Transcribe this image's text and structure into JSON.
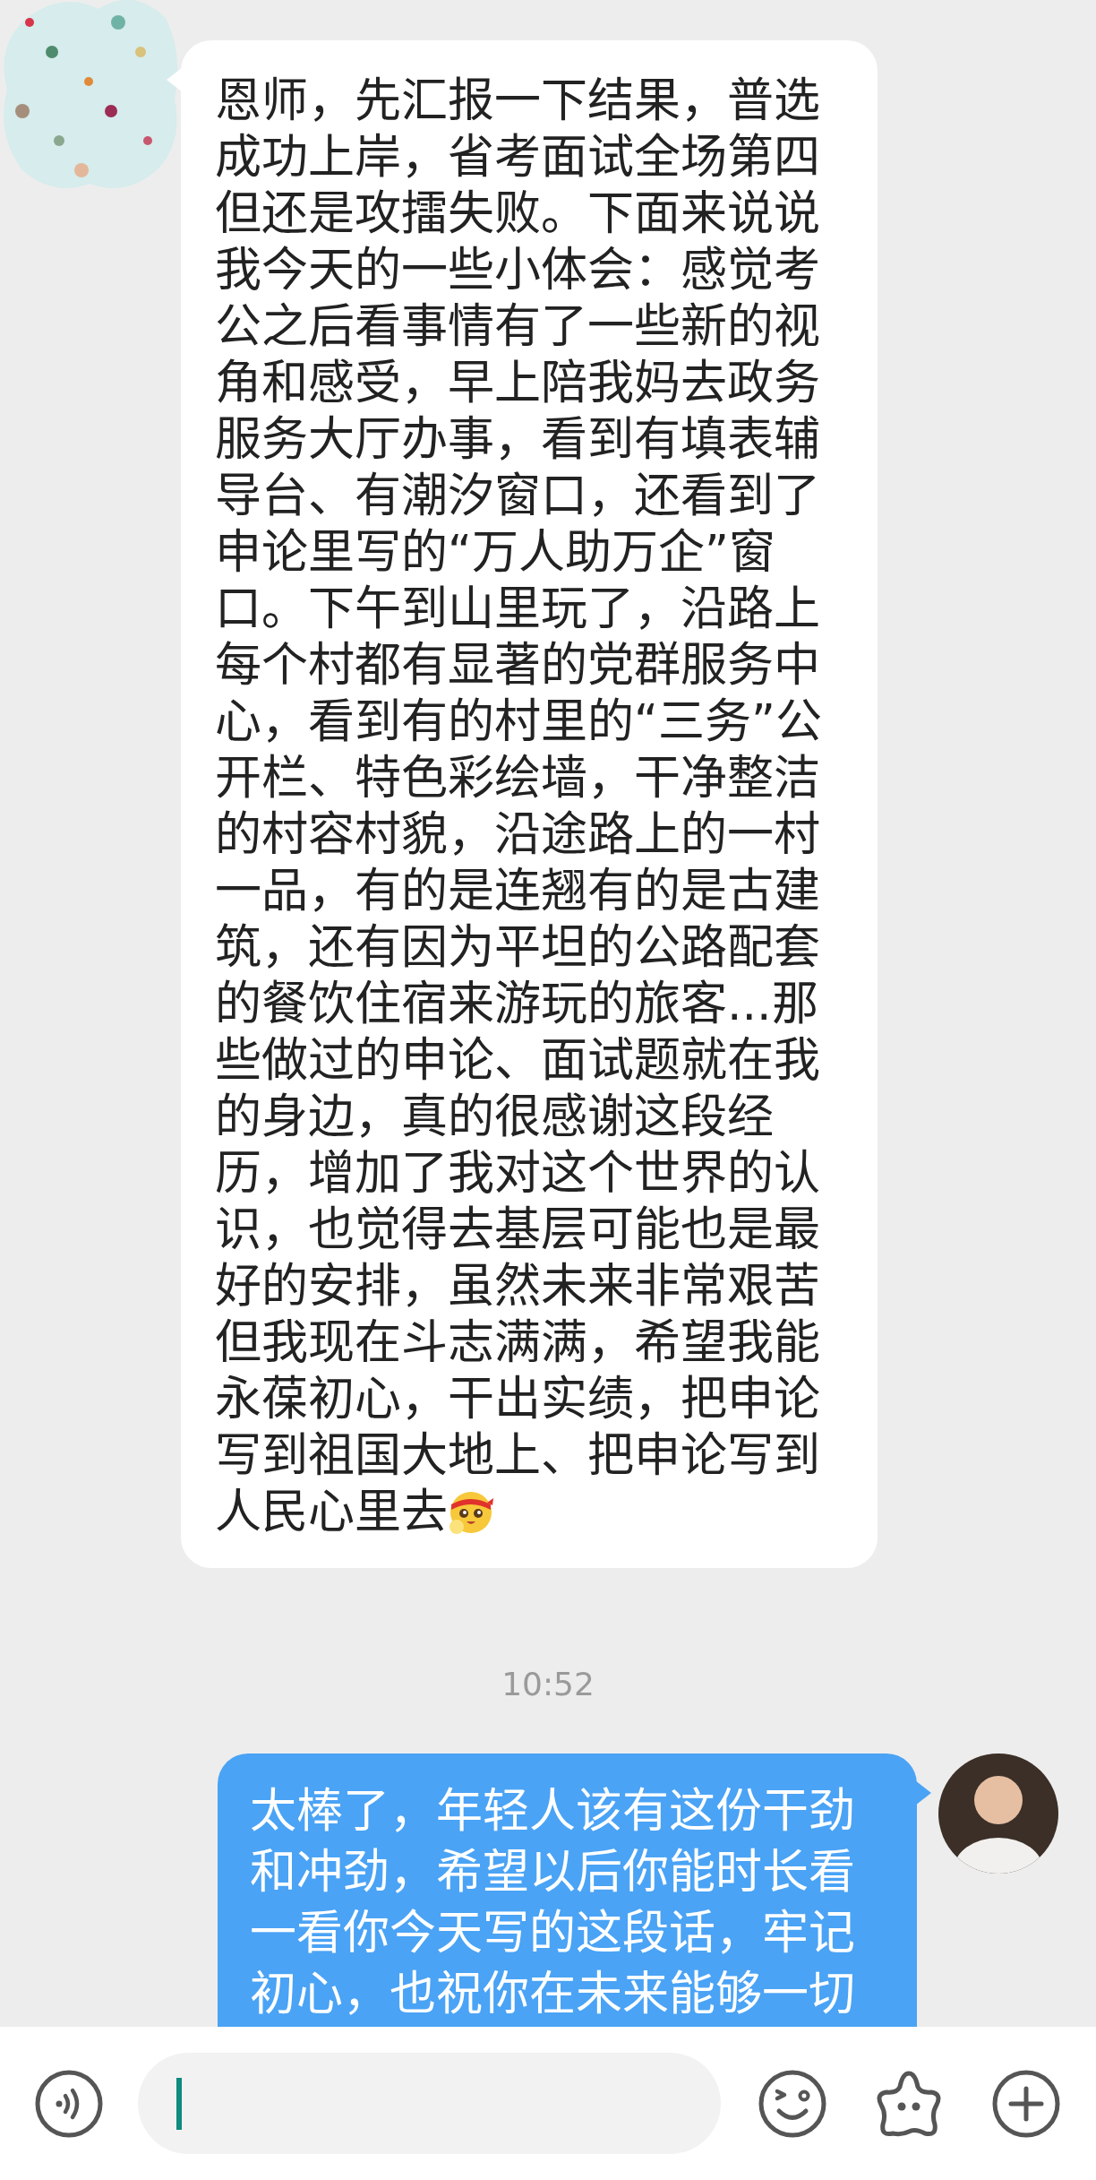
{
  "messages": [
    {
      "kind": "received",
      "text": "恩师，先汇报一下结果，普选成功上岸，省考面试全场第四但还是攻擂失败。下面来说说我今天的一些小体会：感觉考公之后看事情有了一些新的视角和感受，早上陪我妈去政务服务大厅办事，看到有填表辅导台、有潮汐窗口，还看到了申论里写的“万人助万企”窗口。下午到山里玩了，沿路上每个村都有显著的党群服务中心，看到有的村里的“三务”公开栏、特色彩绘墙，干净整洁的村容村貌，沿途路上的一村一品，有的是连翘有的是古建筑，还有因为平坦的公路配套的餐饮住宿来游玩的旅客...那些做过的申论、面试题就在我的身边，真的很感谢这段经历，增加了我对这个世界的认识，也觉得去基层可能也是最好的安排，虽然未来非常艰苦但我现在斗志满满，希望我能永葆初心，干出实绩，把申论写到祖国大地上、把申论写到人民心里去",
      "trailing_emoji": true
    },
    {
      "kind": "time",
      "text": "10:52"
    },
    {
      "kind": "sent",
      "text": "太棒了，年轻人该有这份干劲和冲劲，希望以后你能时长看一看你今天写的这段话，牢记初心，也祝你在未来能够一切"
    }
  ],
  "input_bar": {
    "focused": true
  }
}
